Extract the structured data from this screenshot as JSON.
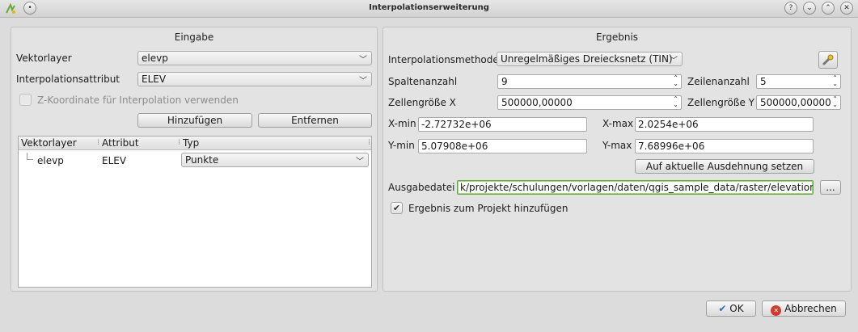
{
  "window": {
    "title": "Interpolationserweiterung",
    "help": "?"
  },
  "input": {
    "group_title": "Eingabe",
    "vector_layer_label": "Vektorlayer",
    "vector_layer_value": "elevp",
    "attribute_label": "Interpolationsattribut",
    "attribute_value": "ELEV",
    "z_coord_label": "Z-Koordinate für Interpolation verwenden",
    "add_button": "Hinzufügen",
    "remove_button": "Entfernen",
    "table": {
      "headers": [
        "Vektorlayer",
        "Attribut",
        "Typ"
      ],
      "rows": [
        {
          "layer": "elevp",
          "attribute": "ELEV",
          "type": "Punkte"
        }
      ]
    }
  },
  "output": {
    "group_title": "Ergebnis",
    "method_label": "Interpolationsmethode",
    "method_value": "Unregelmäßiges Dreiecksnetz (TIN)",
    "columns_label": "Spaltenanzahl",
    "columns_value": "9",
    "rows_label": "Zeilenanzahl",
    "rows_value": "5",
    "cellsize_x_label": "Zellengröße X",
    "cellsize_x_value": "500000,00000",
    "cellsize_y_label": "Zellengröße Y",
    "cellsize_y_value": "500000,00000",
    "xmin_label": "X-min",
    "xmin_value": "-2.72732e+06",
    "xmax_label": "X-max",
    "xmax_value": "2.0254e+06",
    "ymin_label": "Y-min",
    "ymin_value": "5.07908e+06",
    "ymax_label": "Y-max",
    "ymax_value": "7.68996e+06",
    "extent_button": "Auf aktuelle Ausdehnung setzen",
    "output_file_label": "Ausgabedatei",
    "output_file_value": "k/projekte/schulungen/vorlagen/daten/qgis_sample_data/raster/elevation_tin",
    "browse_button": "...",
    "add_to_project_label": "Ergebnis zum Projekt hinzufügen"
  },
  "footer": {
    "ok_button": "OK",
    "cancel_button": "Abbrechen"
  },
  "colors": {
    "active_border": "#5faa3a",
    "ok_check": "#2d6fb8",
    "cancel_red": "#d6392b"
  }
}
